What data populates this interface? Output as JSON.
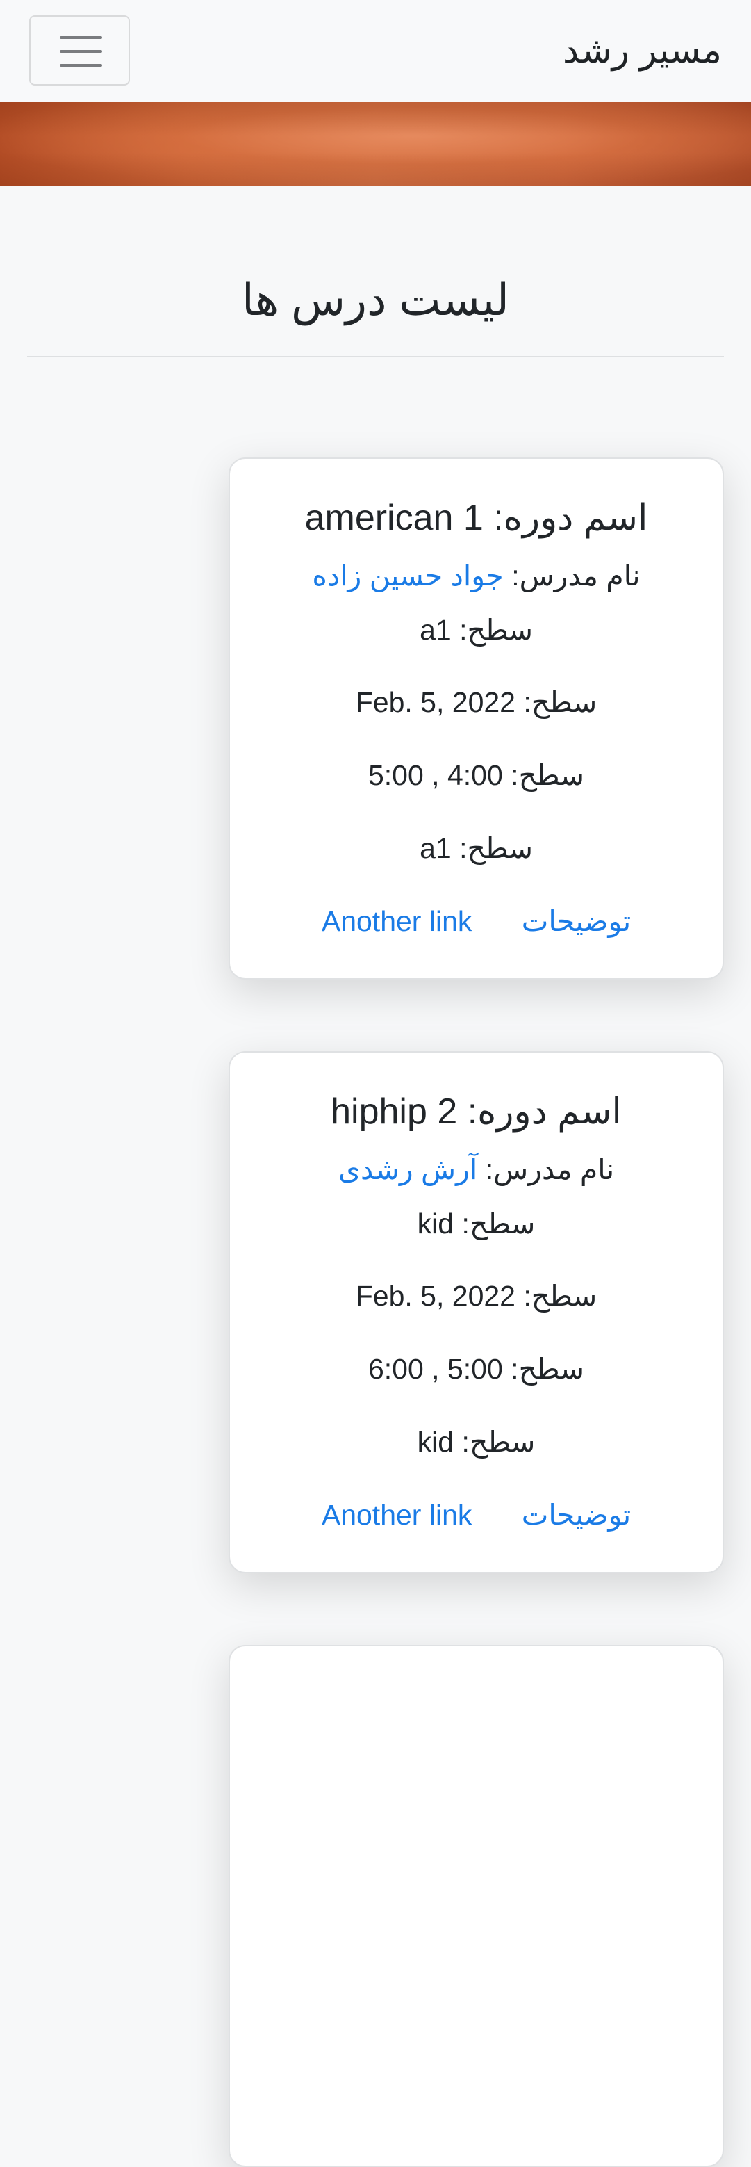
{
  "navbar": {
    "brand": "مسیر رشد",
    "toggler_icon": "hamburger-menu-icon"
  },
  "page": {
    "title": "لیست درس ها"
  },
  "labels": {
    "course_name": "اسم دوره:",
    "teacher": "نام مدرس:",
    "level": "سطح:"
  },
  "courses": [
    {
      "name": "american 1",
      "teacher": "جواد حسین زاده",
      "level": "a1",
      "date": "Feb. 5, 2022",
      "time": "5:00 , 4:00",
      "level_again": "a1",
      "details_link": "توضیحات",
      "another_link": "Another link"
    },
    {
      "name": "hiphip 2",
      "teacher": "آرش رشدی",
      "level": "kid",
      "date": "Feb. 5, 2022",
      "time": "6:00 , 5:00",
      "level_again": "kid",
      "details_link": "توضیحات",
      "another_link": "Another link"
    }
  ],
  "colors": {
    "link": "#1a7be6",
    "banner": "#d26a3c",
    "navbar_bg": "#f8f9fa"
  }
}
